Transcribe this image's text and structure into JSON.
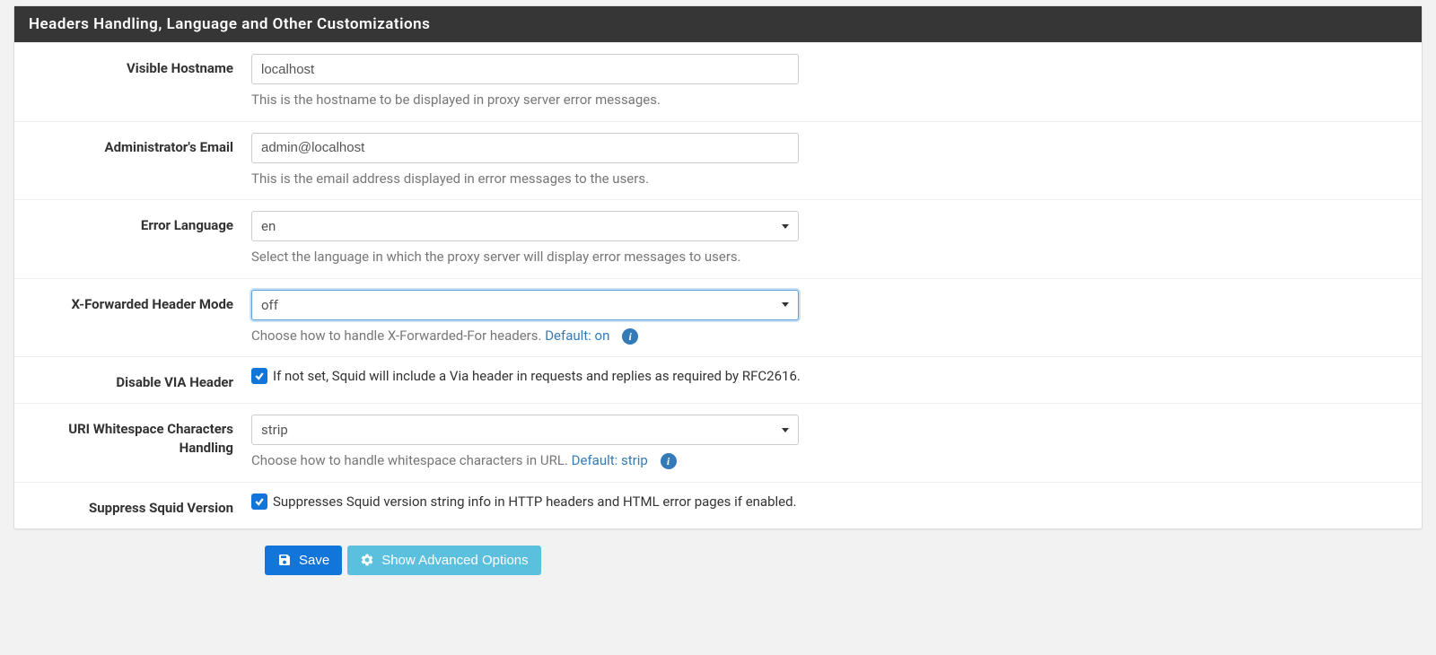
{
  "panel": {
    "title": "Headers Handling, Language and Other Customizations"
  },
  "fields": {
    "visible_hostname": {
      "label": "Visible Hostname",
      "value": "localhost",
      "help": "This is the hostname to be displayed in proxy server error messages."
    },
    "admin_email": {
      "label": "Administrator's Email",
      "value": "admin@localhost",
      "help": "This is the email address displayed in error messages to the users."
    },
    "error_language": {
      "label": "Error Language",
      "value": "en",
      "help": "Select the language in which the proxy server will display error messages to users."
    },
    "x_forwarded": {
      "label": "X-Forwarded Header Mode",
      "value": "off",
      "help_prefix": "Choose how to handle X-Forwarded-For headers. ",
      "default_link": "Default: on"
    },
    "disable_via": {
      "label": "Disable VIA Header",
      "checkbox_text": "If not set, Squid will include a Via header in requests and replies as required by RFC2616."
    },
    "uri_whitespace": {
      "label": "URI Whitespace Characters Handling",
      "value": "strip",
      "help_prefix": "Choose how to handle whitespace characters in URL. ",
      "default_link": "Default: strip"
    },
    "suppress_version": {
      "label": "Suppress Squid Version",
      "checkbox_text": "Suppresses Squid version string info in HTTP headers and HTML error pages if enabled."
    }
  },
  "buttons": {
    "save": "Save",
    "advanced": "Show Advanced Options"
  }
}
